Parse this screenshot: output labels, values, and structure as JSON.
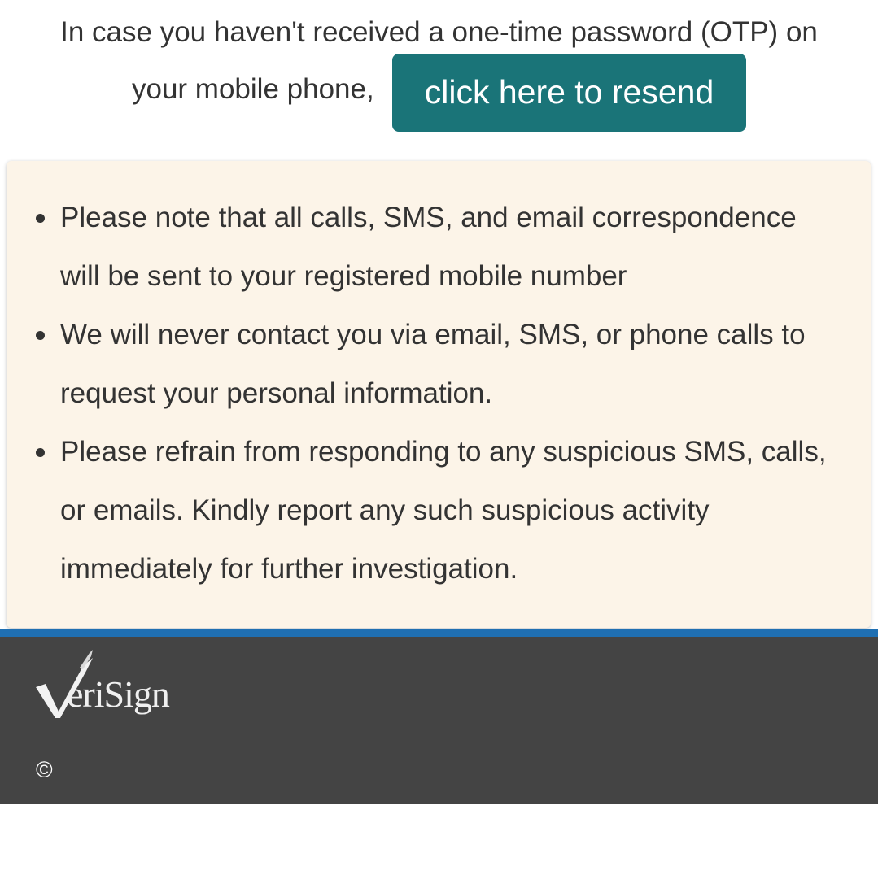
{
  "otp": {
    "line1": "In case you haven't received a one-time password (OTP) on",
    "line2": "your mobile phone,",
    "resend_label": "click here to resend"
  },
  "notices": [
    "Please note that all calls, SMS, and email correspondence will be sent to your registered mobile number",
    "We will never contact you via email, SMS, or phone calls to request your personal information.",
    "Please refrain from responding to any suspicious SMS, calls, or emails. Kindly report any such suspicious activity immediately for further investigation."
  ],
  "footer": {
    "logo_text": "VeriSign",
    "copyright": "©"
  },
  "colors": {
    "button_bg": "#1a7478",
    "notice_bg": "#fcf4e8",
    "footer_bg": "#444444",
    "footer_accent": "#1f6fb2"
  }
}
